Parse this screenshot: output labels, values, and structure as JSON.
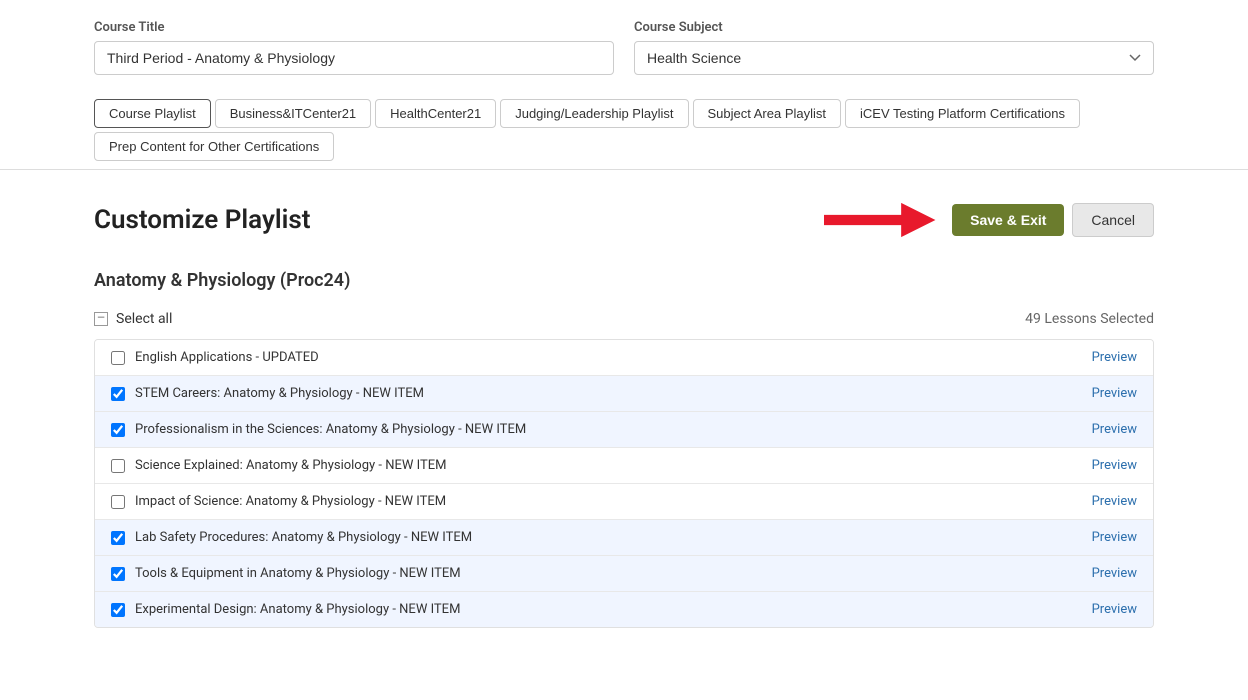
{
  "form": {
    "title_label": "Course Title",
    "title_value": "Third Period - Anatomy & Physiology",
    "subject_label": "Course Subject",
    "subject_value": "Health Science"
  },
  "tabs": [
    {
      "id": "course-playlist",
      "label": "Course Playlist",
      "active": true
    },
    {
      "id": "business-it",
      "label": "Business&ITCenter21",
      "active": false
    },
    {
      "id": "health-center",
      "label": "HealthCenter21",
      "active": false
    },
    {
      "id": "judging-leadership",
      "label": "Judging/Leadership Playlist",
      "active": false
    },
    {
      "id": "subject-area",
      "label": "Subject Area Playlist",
      "active": false
    },
    {
      "id": "icev-testing",
      "label": "iCEV Testing Platform Certifications",
      "active": false
    },
    {
      "id": "prep-content",
      "label": "Prep Content for Other Certifications",
      "active": false
    }
  ],
  "main": {
    "page_title": "Customize Playlist",
    "save_exit_label": "Save & Exit",
    "cancel_label": "Cancel",
    "course_name": "Anatomy & Physiology (Proc24)",
    "select_all_label": "Select all",
    "lessons_count": "49 Lessons Selected"
  },
  "lessons": [
    {
      "id": 1,
      "name": "English Applications - UPDATED",
      "checked": false,
      "preview": "Preview"
    },
    {
      "id": 2,
      "name": "STEM Careers: Anatomy & Physiology - NEW ITEM",
      "checked": true,
      "preview": "Preview"
    },
    {
      "id": 3,
      "name": "Professionalism in the Sciences: Anatomy & Physiology - NEW ITEM",
      "checked": true,
      "preview": "Preview"
    },
    {
      "id": 4,
      "name": "Science Explained: Anatomy & Physiology - NEW ITEM",
      "checked": false,
      "preview": "Preview"
    },
    {
      "id": 5,
      "name": "Impact of Science: Anatomy & Physiology - NEW ITEM",
      "checked": false,
      "preview": "Preview"
    },
    {
      "id": 6,
      "name": "Lab Safety Procedures: Anatomy & Physiology - NEW ITEM",
      "checked": true,
      "preview": "Preview"
    },
    {
      "id": 7,
      "name": "Tools & Equipment in Anatomy & Physiology - NEW ITEM",
      "checked": true,
      "preview": "Preview"
    },
    {
      "id": 8,
      "name": "Experimental Design: Anatomy & Physiology - NEW ITEM",
      "checked": true,
      "preview": "Preview"
    }
  ]
}
